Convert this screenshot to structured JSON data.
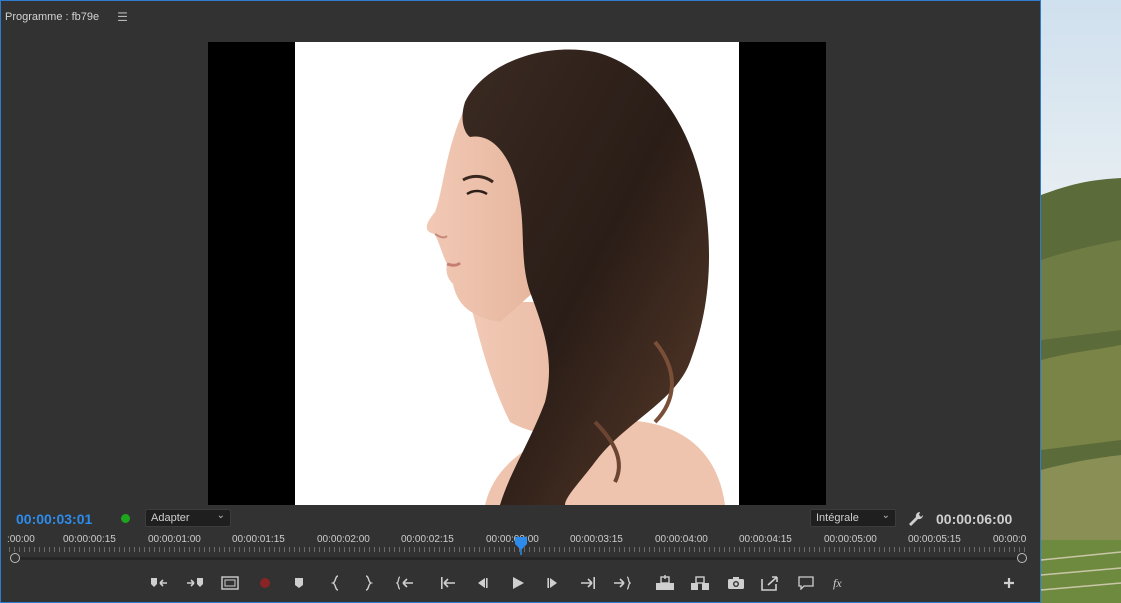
{
  "panel": {
    "title": "Programme : fb79e",
    "menu_icon": "☰"
  },
  "controls": {
    "current_timecode": "00:00:03:01",
    "zoom": "Adapter",
    "quality": "Intégrale",
    "duration": "00:00:06:00"
  },
  "ruler": {
    "labels": [
      ":00:00",
      "00:00:00:15",
      "00:00:01:00",
      "00:00:01:15",
      "00:00:02:00",
      "00:00:02:15",
      "00:00:03:00",
      "00:00:03:15",
      "00:00:04:00",
      "00:00:04:15",
      "00:00:05:00",
      "00:00:05:15",
      "00:00:0"
    ]
  },
  "transport_buttons": [
    "mark-in-icon",
    "mark-out-icon",
    "safe-margins-icon",
    "record-icon",
    "add-marker-icon",
    "mark-in-brace-icon",
    "mark-out-brace-icon",
    "go-to-in-icon",
    "go-to-previous-edit-icon",
    "step-back-icon",
    "play-icon",
    "step-forward-icon",
    "go-to-next-edit-icon",
    "go-to-out-icon",
    "lift-icon",
    "extract-icon",
    "export-frame-icon",
    "compare-view-icon",
    "comment-icon",
    "fx-icon",
    "add-button-icon"
  ],
  "colors": {
    "timecode_accent": "#2d8ceb",
    "status_dot": "#1ea51e",
    "panel_border": "#2f7bd0"
  }
}
